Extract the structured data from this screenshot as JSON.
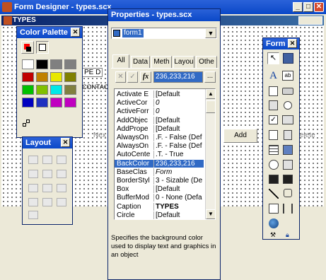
{
  "form_designer": {
    "title": "Form Designer - types.scx",
    "form_caption": "TYPES",
    "add_button": "Add",
    "next_fragment": "Nex",
    "delete_fragment": "elete",
    "type_fragment": "PE D",
    "contact_fragment": "CONTAC"
  },
  "color_palette": {
    "title": "Color Palette",
    "swatches": [
      "#ffffff",
      "#000000",
      "#808080",
      "#808080",
      "#c00000",
      "#c08000",
      "#e8e800",
      "#808000",
      "#00c000",
      "#80c000",
      "#00e8e8",
      "#808040",
      "#0000c0",
      "#2030c0",
      "#c000c0",
      "#c000c0"
    ],
    "fg_color": "#ff0000",
    "bg_color": "#000000"
  },
  "layout": {
    "title": "Layout"
  },
  "properties": {
    "title": "Properties - types.scx",
    "object_select": "form1",
    "tabs": [
      "All",
      "Data",
      "Meth",
      "Layou",
      "Othe"
    ],
    "value_box": "236,233,216",
    "fx_label": "fx",
    "browse_label": "...",
    "rows": [
      {
        "name": "Activate E",
        "value": "[Default"
      },
      {
        "name": "ActiveCor",
        "value": "0"
      },
      {
        "name": "ActiveForr",
        "value": "0"
      },
      {
        "name": "AddObjec",
        "value": "[Default"
      },
      {
        "name": "AddPrope",
        "value": "[Default"
      },
      {
        "name": "AlwaysOn",
        "value": ".F. - False (Defa"
      },
      {
        "name": "AlwaysOn",
        "value": ".F. - False (Defa"
      },
      {
        "name": "AutoCente",
        "value": ".T. - True"
      },
      {
        "name": "BackColor",
        "value": "236,233,216"
      },
      {
        "name": "BaseClas",
        "value": "Form"
      },
      {
        "name": "BorderStyl",
        "value": "3 - Sizable (Defa"
      },
      {
        "name": "Box",
        "value": "[Default"
      },
      {
        "name": "BufferMod",
        "value": "0 - None (Defa"
      },
      {
        "name": "Caption",
        "value": "TYPES"
      },
      {
        "name": "Circle",
        "value": "[Default"
      }
    ],
    "selected_index": 8,
    "description": "Specifies the background color used to display text and graphics in an object"
  },
  "form_controls": {
    "title": "Form C"
  }
}
